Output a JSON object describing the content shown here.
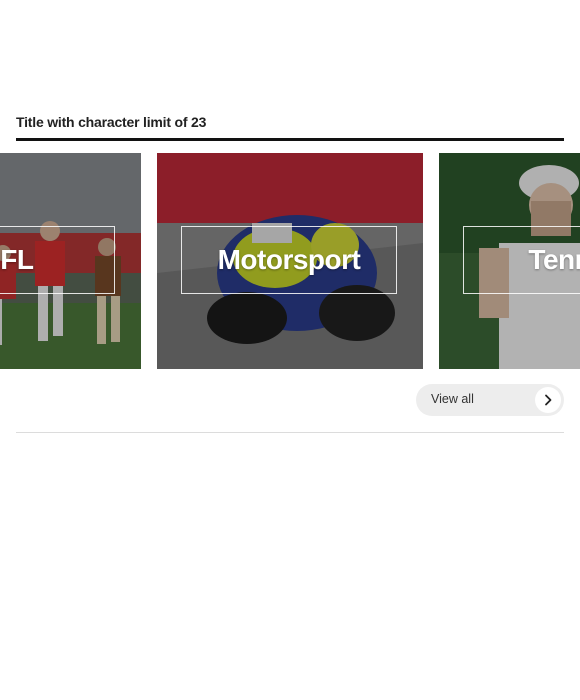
{
  "section": {
    "title": "Title with character limit of 23"
  },
  "cards": [
    {
      "label": "AFL",
      "image": "afl-players-running-photo"
    },
    {
      "label": "Motorsport",
      "image": "motorcycle-racer-cornering-photo"
    },
    {
      "label": "Tennis",
      "image": "tennis-player-photo"
    }
  ],
  "view_all": {
    "label": "View all",
    "icon": "chevron-right-icon"
  },
  "colors": {
    "title_text": "#222222",
    "rule": "#121212",
    "pill_background": "#ededed",
    "card_label": "#ffffff"
  }
}
